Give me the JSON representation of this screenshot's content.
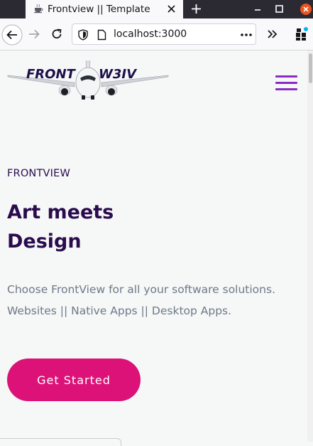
{
  "browser": {
    "tab_title": "Frontview || Template",
    "url": "localhost:3000",
    "icons": [
      "teacup-icon",
      "close-tab-icon",
      "new-tab-icon",
      "minimize-icon",
      "maximize-icon",
      "window-close-icon",
      "back-arrow-icon",
      "forward-arrow-icon",
      "reload-icon",
      "shield-icon",
      "page-icon",
      "more-icon",
      "overflow-chevrons-icon",
      "extensions-icon"
    ]
  },
  "header": {
    "logo_text_left": "FRONT",
    "logo_text_right": "W3IV",
    "logo_color": "#1d0f4a",
    "menu_color": "#8b2bc4"
  },
  "hero": {
    "eyebrow": "FRONTVIEW",
    "headline_line1": "Art meets",
    "headline_line2": "Design",
    "description_line1": "Choose FrontView for all your software solutions.",
    "description_line2": "Websites || Native Apps || Desktop Apps.",
    "cta_label": "Get Started",
    "cta_color": "#dc1278",
    "heading_color": "#2a0c4e",
    "text_color": "#6c7a89"
  }
}
